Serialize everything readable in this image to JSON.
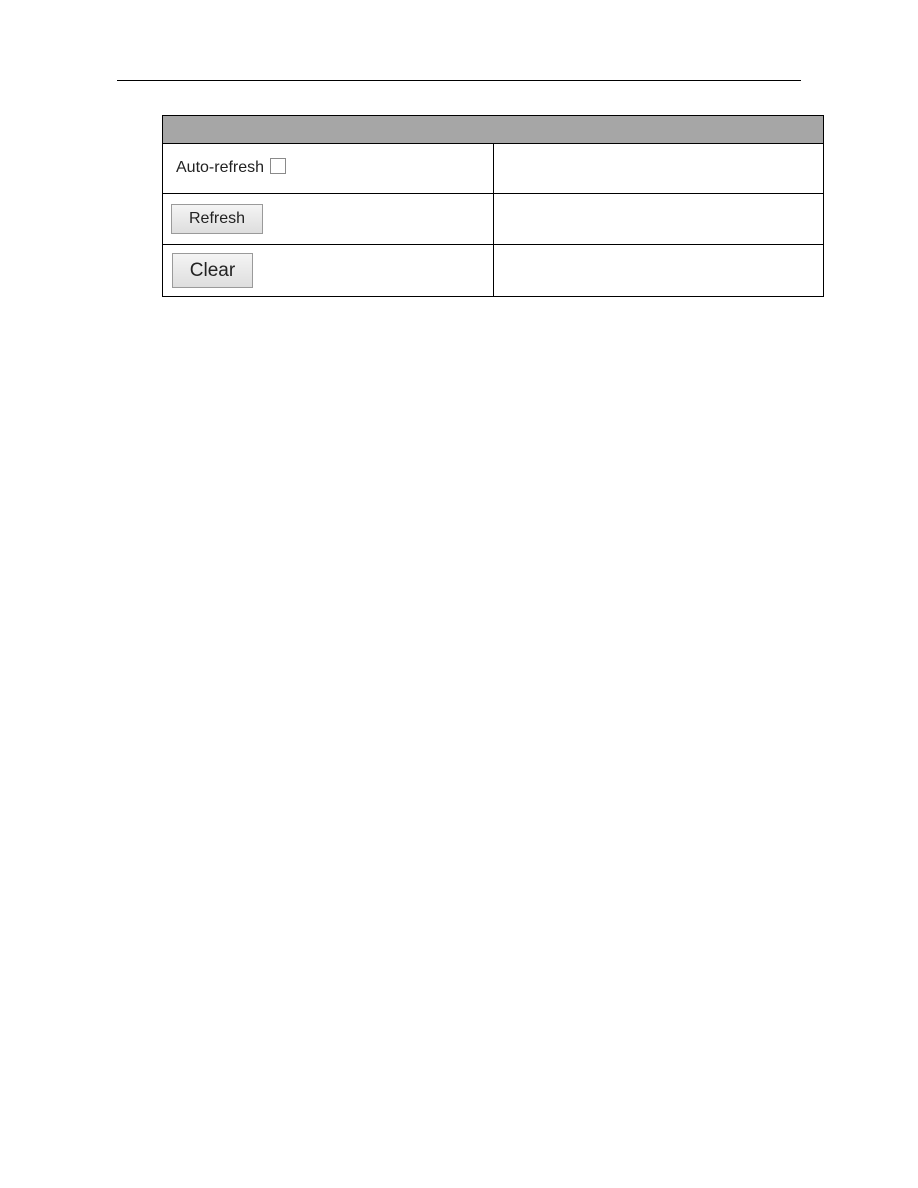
{
  "header": {
    "title": ""
  },
  "controls": {
    "auto_refresh": {
      "label": "Auto-refresh",
      "checked": false
    },
    "refresh_button": {
      "label": "Refresh",
      "description": ""
    },
    "clear_button": {
      "label": "Clear",
      "description": ""
    },
    "auto_refresh_description": ""
  },
  "colors": {
    "header_bar": "#a6a6a6",
    "border": "#000000"
  }
}
